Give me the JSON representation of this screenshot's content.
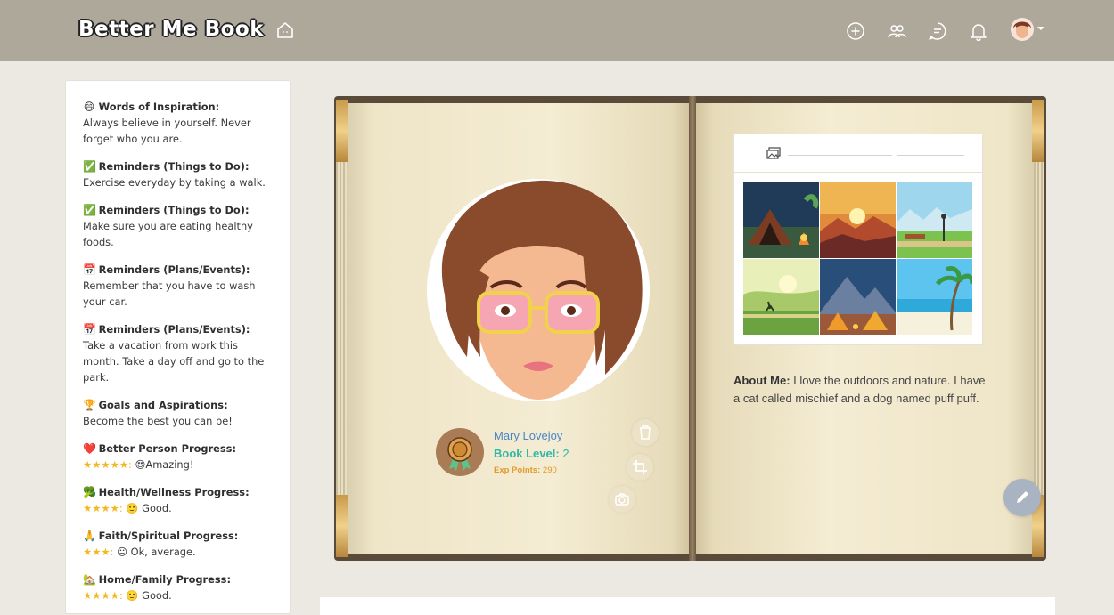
{
  "header": {
    "brand": "Better Me Book",
    "icons": [
      "home-icon",
      "add-icon",
      "friends-icon",
      "messages-icon",
      "notifications-icon"
    ]
  },
  "sidebar": {
    "items": [
      {
        "icon": "😄",
        "title": "Words of Inspiration:",
        "text": "Always believe in yourself. Never forget who you are."
      },
      {
        "icon": "✅",
        "title": "Reminders (Things to Do):",
        "text": "Exercise everyday by taking a walk."
      },
      {
        "icon": "✅",
        "title": "Reminders (Things to Do):",
        "text": "Make sure you are eating healthy foods."
      },
      {
        "icon": "📅",
        "title": "Reminders (Plans/Events):",
        "text": "Remember that you have to wash your car."
      },
      {
        "icon": "📅",
        "title": "Reminders (Plans/Events):",
        "text": "Take a vacation from work this month. Take a day off and go to the park."
      },
      {
        "icon": "🏆",
        "title": "Goals and Aspirations:",
        "text": "Become the best you can be!"
      },
      {
        "icon": "❤️",
        "title": "Better Person Progress:",
        "stars": "★★★★★:",
        "text": "😍Amazing!"
      },
      {
        "icon": "🥦",
        "title": "Health/Wellness Progress:",
        "stars": "★★★★:",
        "text": "🙂 Good."
      },
      {
        "icon": "🙏",
        "title": "Faith/Spiritual Progress:",
        "stars": "★★★:",
        "text": "😐 Ok, average."
      },
      {
        "icon": "🏡",
        "title": "Home/Family Progress:",
        "stars": "★★★★:",
        "text": "🙂 Good."
      }
    ]
  },
  "profile": {
    "name": "Mary Lovejoy",
    "level_label": "Book Level:",
    "level_value": "2",
    "exp_label": "Exp Points:",
    "exp_value": "290"
  },
  "about": {
    "label": "About Me:",
    "text": " I love the outdoors and nature. I have a cat called mischief and a dog named puff puff."
  },
  "gallery": {
    "thumbnails": [
      "camping-tent-night",
      "sunset-mountains",
      "park-bench",
      "morning-runner",
      "mountain-camp-fire",
      "tropical-beach"
    ]
  },
  "colors": {
    "topbar": "#aea89b",
    "name": "#4a86c8",
    "level": "#2fb8a6",
    "exp": "#e09a2a",
    "star": "#f3b922"
  }
}
